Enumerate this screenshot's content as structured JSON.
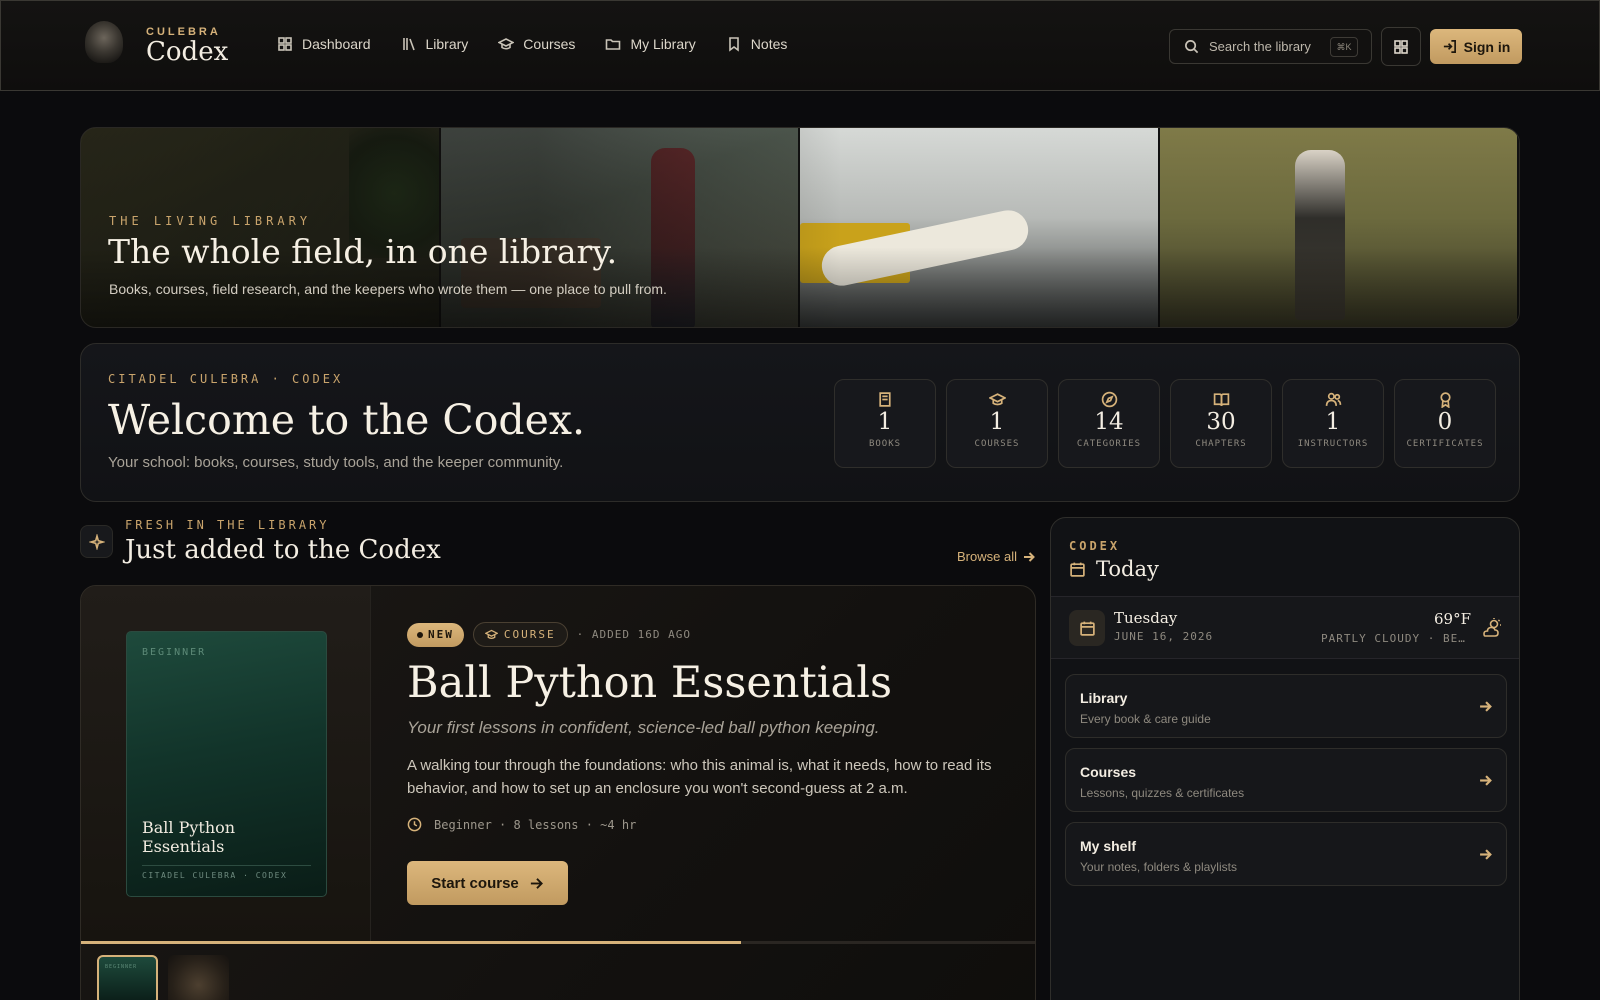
{
  "header": {
    "brand_small": "CULEBRA",
    "brand_name": "Codex",
    "nav": [
      {
        "label": "Dashboard",
        "icon": "dashboard-icon"
      },
      {
        "label": "Library",
        "icon": "library-icon"
      },
      {
        "label": "Courses",
        "icon": "graduation-cap-icon"
      },
      {
        "label": "My Library",
        "icon": "folder-icon"
      },
      {
        "label": "Notes",
        "icon": "bookmark-icon"
      }
    ],
    "search_placeholder": "Search the library",
    "search_shortcut": "⌘K",
    "signin_label": "Sign in"
  },
  "hero": {
    "kicker": "THE LIVING LIBRARY",
    "title": "The whole field, in one library.",
    "subtitle": "Books, courses, field research, and the keepers who wrote them — one place to pull from."
  },
  "welcome": {
    "kicker": "CITADEL CULEBRA · CODEX",
    "title": "Welcome to the Codex.",
    "subtitle": "Your school: books, courses, study tools, and the keeper community.",
    "stats": [
      {
        "value": "1",
        "label": "BOOKS",
        "icon": "book-icon"
      },
      {
        "value": "1",
        "label": "COURSES",
        "icon": "graduation-cap-icon"
      },
      {
        "value": "14",
        "label": "CATEGORIES",
        "icon": "compass-icon"
      },
      {
        "value": "30",
        "label": "CHAPTERS",
        "icon": "open-book-icon"
      },
      {
        "value": "1",
        "label": "INSTRUCTORS",
        "icon": "users-icon"
      },
      {
        "value": "0",
        "label": "CERTIFICATES",
        "icon": "award-icon"
      }
    ]
  },
  "fresh": {
    "kicker": "FRESH IN THE LIBRARY",
    "title": "Just added to the Codex",
    "browse_label": "Browse all"
  },
  "feature": {
    "cover_level": "BEGINNER",
    "cover_title": "Ball Python Essentials",
    "cover_footer": "CITADEL CULEBRA · CODEX",
    "badge_new": "NEW",
    "badge_type": "COURSE",
    "added": "· ADDED 16D AGO",
    "title": "Ball Python Essentials",
    "tagline": "Your first lessons in confident, science-led ball python keeping.",
    "description": "A walking tour through the foundations: who this animal is, what it needs, how to read its behavior, and how to set up an enclosure you won't second-guess at 2 a.m.",
    "meta": "Beginner · 8 lessons · ~4 hr",
    "cta": "Start course",
    "progress": 0.69,
    "thumb_label": "BEGINNER"
  },
  "today": {
    "kicker": "CODEX",
    "title": "Today",
    "day": "Tuesday",
    "date": "JUNE 16, 2026",
    "temp": "69°F",
    "condition": "PARTLY CLOUDY · BEL…",
    "links": [
      {
        "title": "Library",
        "subtitle": "Every book & care guide"
      },
      {
        "title": "Courses",
        "subtitle": "Lessons, quizzes & certificates"
      },
      {
        "title": "My shelf",
        "subtitle": "Your notes, folders & playlists"
      }
    ]
  },
  "colors": {
    "accent": "#d6b27a",
    "background": "#0b0b0d"
  }
}
